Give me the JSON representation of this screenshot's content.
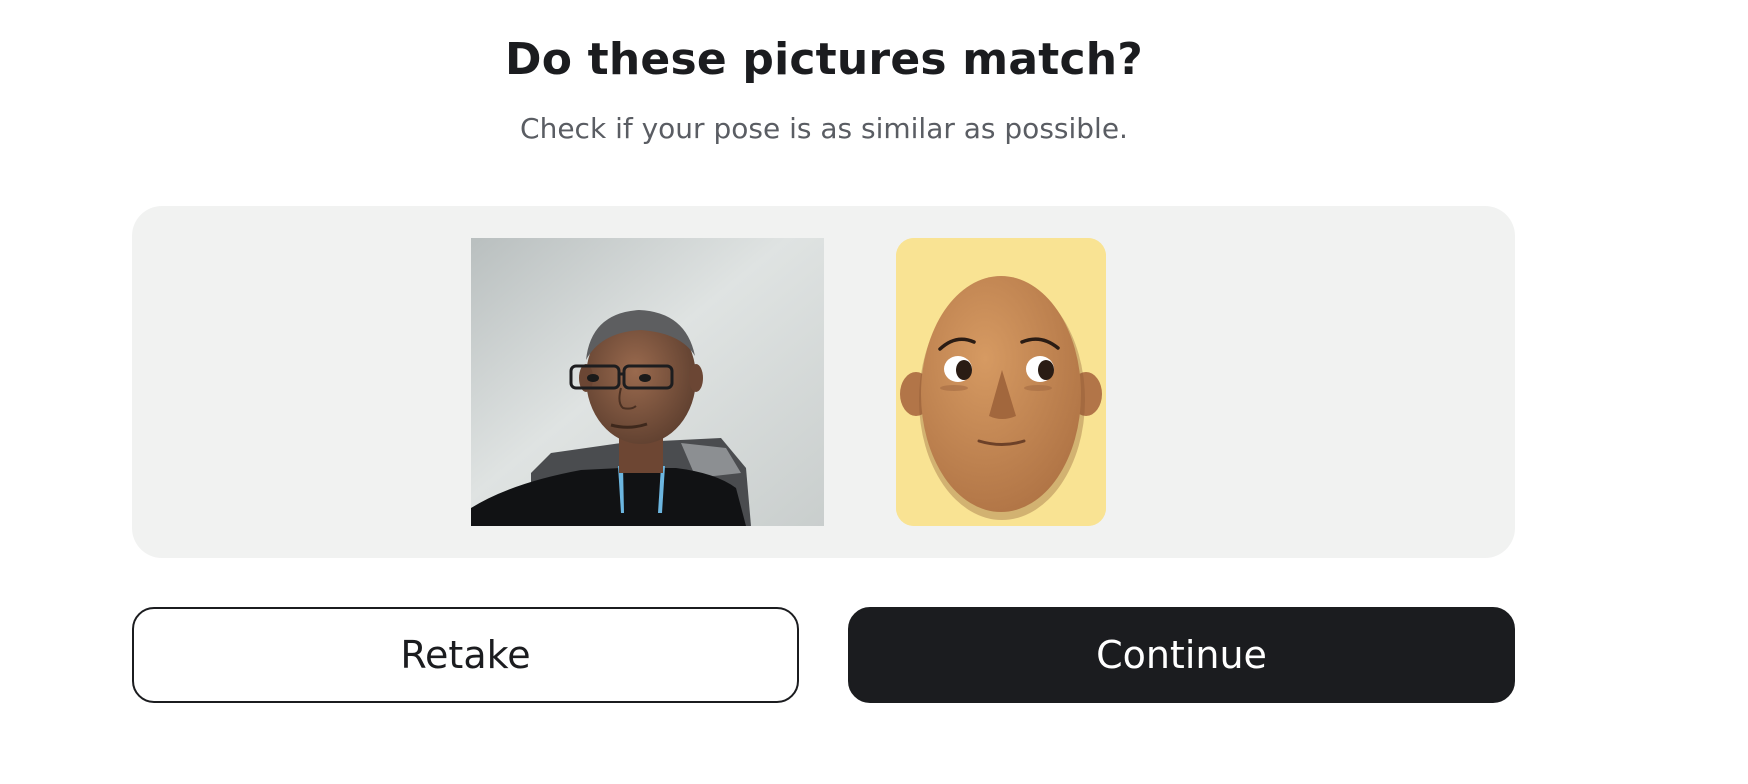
{
  "header": {
    "title": "Do these pictures match?",
    "subtitle": "Check if your pose is as similar as possible."
  },
  "comparison": {
    "photo_icon": "captured-selfie-photo",
    "avatar_icon": "pose-reference-avatar"
  },
  "actions": {
    "retake_label": "Retake",
    "continue_label": "Continue"
  },
  "colors": {
    "primary_button": "#1b1c1f",
    "panel_background": "#f1f2f1",
    "avatar_background": "#f9e393",
    "avatar_skin": "#c98a52"
  }
}
